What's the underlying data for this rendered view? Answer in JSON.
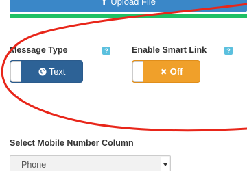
{
  "upload": {
    "label": "Upload File",
    "icon": "upload-icon"
  },
  "progress": {
    "value": 1.0,
    "color": "#1ec065"
  },
  "message_type": {
    "label": "Message Type",
    "help": "?",
    "toggle_state": "Text",
    "toggle_icon": "globe-icon",
    "color": "#2d6296"
  },
  "smart_link": {
    "label": "Enable Smart Link",
    "help": "?",
    "toggle_state": "Off",
    "toggle_icon": "close-icon",
    "color": "#f0a02a"
  },
  "mobile_column": {
    "label": "Select Mobile Number Column",
    "selected": "Phone"
  },
  "annotation": {
    "shape": "ellipse",
    "color": "#e8261a"
  }
}
